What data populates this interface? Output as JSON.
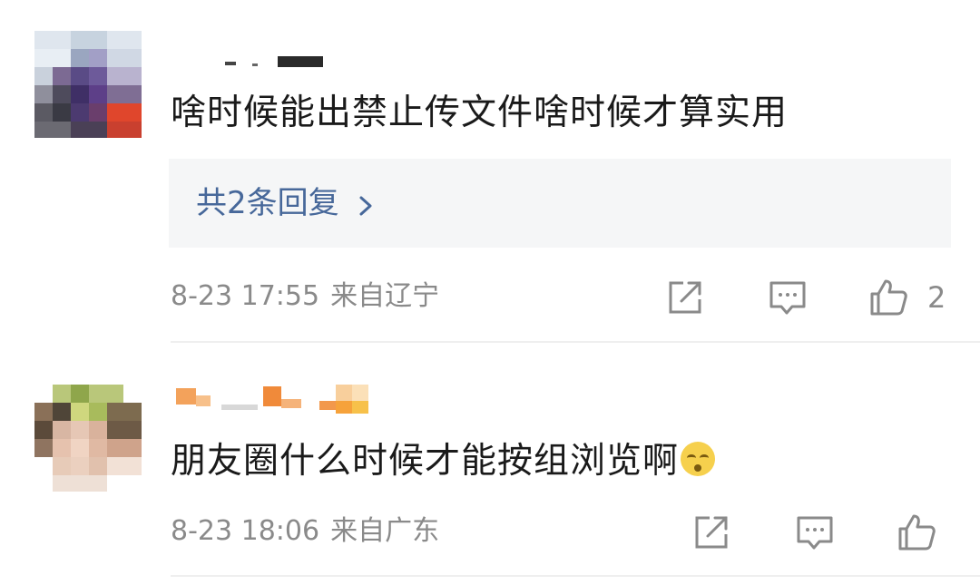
{
  "comments": [
    {
      "text": "啥时候能出禁止传文件啥时候才算实用",
      "replies_label": "共2条回复",
      "date": "8-23 17:55",
      "location": "来自辽宁",
      "like_count": "2",
      "icons": [
        "share-icon",
        "comment-icon",
        "like-icon",
        "chevron-right-icon"
      ]
    },
    {
      "text": "朋友圈什么时候才能按组浏览啊",
      "emoji": "rolling-eyes-emoji-icon",
      "date": "8-23 18:06",
      "location": "来自广东",
      "icons": [
        "share-icon",
        "comment-icon",
        "like-icon"
      ]
    }
  ],
  "colors": {
    "link": "#47689a",
    "meta": "#8a8a8a",
    "reply_bg": "#f5f6f7",
    "divider": "#efefef"
  }
}
